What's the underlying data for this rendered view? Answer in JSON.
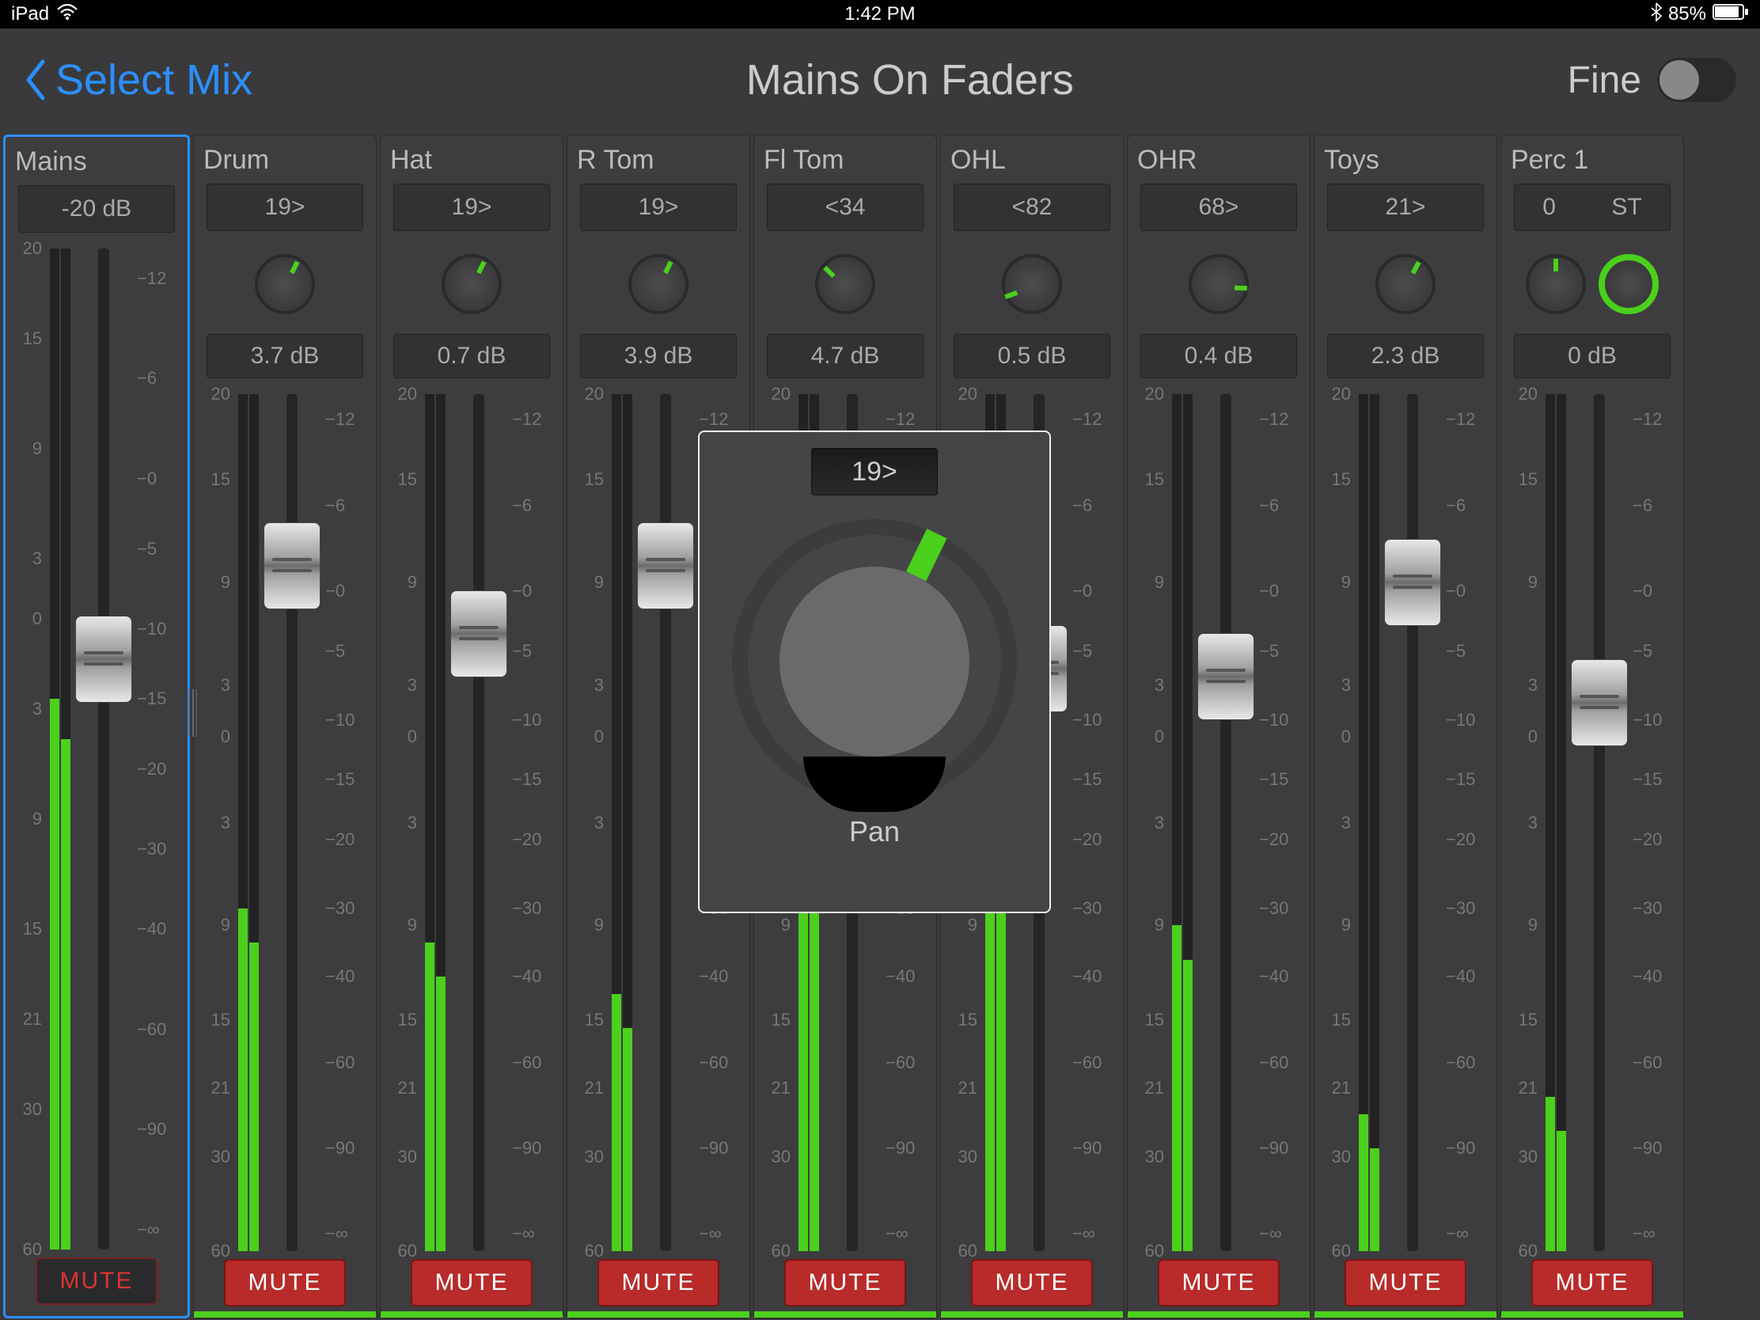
{
  "status": {
    "device": "iPad",
    "time": "1:42 PM",
    "battery": "85%"
  },
  "header": {
    "back": "Select Mix",
    "title": "Mains On Faders",
    "fine": "Fine"
  },
  "popup": {
    "value": "19>",
    "label": "Pan"
  },
  "mains": {
    "name": "Mains",
    "trim": "-20 dB",
    "scale_left": [
      "20",
      "15",
      "9",
      "3",
      "0",
      "3",
      "9",
      "15",
      "21",
      "30",
      "60"
    ],
    "scale_right": [
      "−12",
      "−6",
      "−0",
      "−5",
      "−10",
      "−15",
      "−20",
      "−30",
      "−40",
      "−60",
      "−90",
      "−∞"
    ],
    "meter": 55,
    "fader": 41,
    "mute": "MUTE"
  },
  "ch_scale_left": [
    "20",
    "15",
    "9",
    "3",
    "0",
    "3",
    "9",
    "15",
    "21",
    "30",
    "60"
  ],
  "ch_scale_right": [
    "−12",
    "−6",
    "−0",
    "−5",
    "−10",
    "−15",
    "−20",
    "−30",
    "−40",
    "−60",
    "−90",
    "−∞"
  ],
  "channels": [
    {
      "name": "Drum",
      "pan": "19>",
      "pan_deg": 26,
      "gain": "3.7 dB",
      "meter": 40,
      "fader": 20,
      "mute": "MUTE"
    },
    {
      "name": "Hat",
      "pan": "19>",
      "pan_deg": 26,
      "gain": "0.7 dB",
      "meter": 36,
      "fader": 28,
      "mute": "MUTE"
    },
    {
      "name": "R Tom",
      "pan": "19>",
      "pan_deg": 26,
      "gain": "3.9 dB",
      "meter": 30,
      "fader": 20,
      "mute": "MUTE"
    },
    {
      "name": "Fl Tom",
      "pan": "<34",
      "pan_deg": -46,
      "gain": "4.7 dB",
      "meter": 45,
      "fader": 35,
      "mute": "MUTE"
    },
    {
      "name": "OHL",
      "pan": "<82",
      "pan_deg": -110,
      "gain": "0.5 dB",
      "meter": 44,
      "fader": 32,
      "mute": "MUTE"
    },
    {
      "name": "OHR",
      "pan": "68>",
      "pan_deg": 92,
      "gain": "0.4 dB",
      "meter": 38,
      "fader": 33,
      "mute": "MUTE"
    },
    {
      "name": "Toys",
      "pan": "21>",
      "pan_deg": 28,
      "gain": "2.3 dB",
      "meter": 16,
      "fader": 22,
      "mute": "MUTE"
    },
    {
      "name": "Perc 1",
      "pan": "0",
      "st": "ST",
      "pan_deg": 0,
      "gain": "0 dB",
      "meter": 18,
      "fader": 36,
      "mute": "MUTE"
    }
  ]
}
